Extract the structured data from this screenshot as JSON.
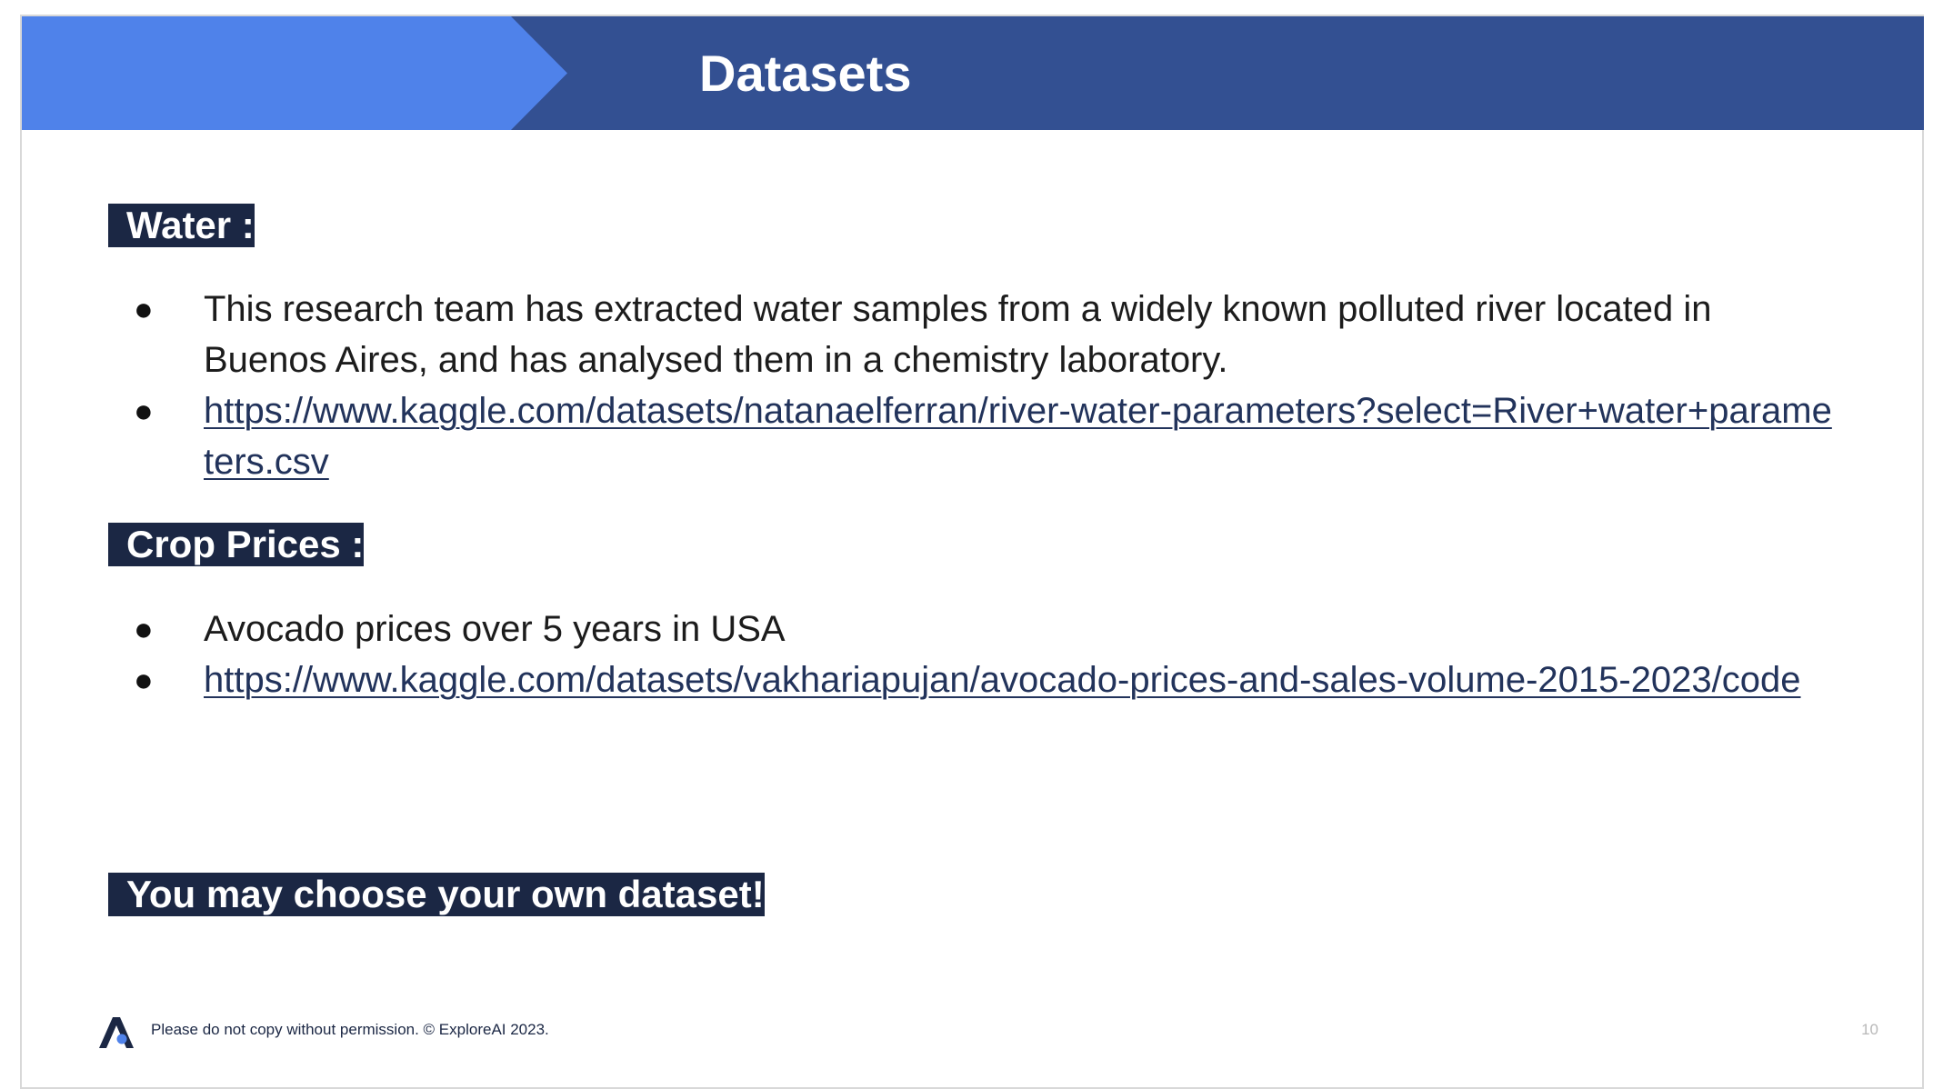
{
  "header": {
    "title": "Datasets"
  },
  "sections": {
    "water": {
      "label": "Water :",
      "description": "This research team has extracted water samples from a widely known polluted river located in Buenos Aires, and has analysed them in a chemistry laboratory.",
      "link": "https://www.kaggle.com/datasets/natanaelferran/river-water-parameters?select=River+water+parameters.csv"
    },
    "crop_prices": {
      "label": "Crop Prices :",
      "description": "Avocado prices over 5 years in USA",
      "link": "https://www.kaggle.com/datasets/vakhariapujan/avocado-prices-and-sales-volume-2015-2023/code"
    },
    "own": {
      "label": "You may choose your own dataset!"
    }
  },
  "footer": {
    "copyright": "Please do not copy without permission. © ExploreAI 2023.",
    "page_number": "10",
    "logo_icon": "explore-ai-logo-icon"
  },
  "colors": {
    "header_dark": "#335092",
    "header_accent": "#4f82ea",
    "label_bg": "#1b2744",
    "link": "#22335b"
  }
}
